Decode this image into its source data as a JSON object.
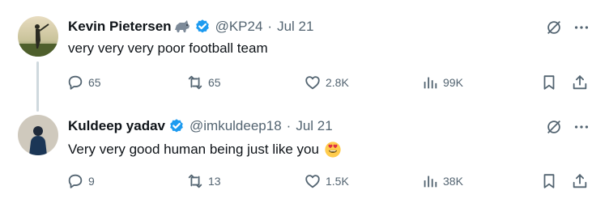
{
  "tweets": [
    {
      "author": {
        "name": "Kevin Pietersen",
        "handle": "@KP24",
        "avatar": "golfer-silhouette-avatar",
        "name_emoji": "rhino-emoji",
        "verified": true
      },
      "separator": "·",
      "date": "Jul 21",
      "text": "very very very poor football team",
      "stats": {
        "replies": "65",
        "retweets": "65",
        "likes": "2.8K",
        "views": "99K"
      }
    },
    {
      "author": {
        "name": "Kuldeep yadav",
        "handle": "@imkuldeep18",
        "avatar": "person-silhouette-avatar",
        "verified": true
      },
      "separator": "·",
      "date": "Jul 21",
      "text": "Very very good human being just like you",
      "text_emoji": "heart-eyes-emoji",
      "stats": {
        "replies": "9",
        "retweets": "13",
        "likes": "1.5K",
        "views": "38K"
      }
    }
  ],
  "colors": {
    "text": "#0f1419",
    "secondary": "#536471",
    "verified_blue": "#1d9bf0",
    "thread_line": "#cfd9de"
  },
  "icons": {
    "reply": "reply-icon",
    "retweet": "retweet-icon",
    "like": "like-icon",
    "views": "views-icon",
    "bookmark": "bookmark-icon",
    "share": "share-icon",
    "grok": "grok-icon",
    "more": "more-icon"
  }
}
